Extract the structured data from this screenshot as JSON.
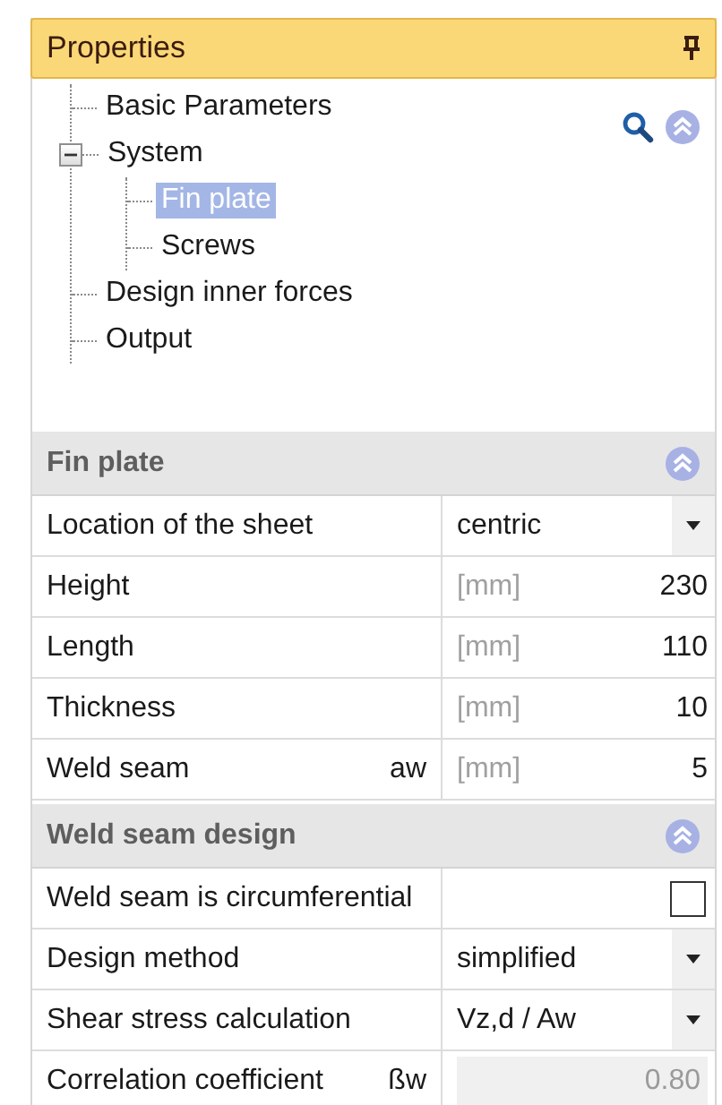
{
  "panel": {
    "title": "Properties",
    "pinned": true
  },
  "tree": [
    {
      "label": "Basic Parameters",
      "selected": false
    },
    {
      "label": "System",
      "selected": false,
      "expanded": true,
      "children": [
        {
          "label": "Fin plate",
          "selected": true
        },
        {
          "label": "Screws",
          "selected": false
        }
      ]
    },
    {
      "label": "Design inner forces",
      "selected": false
    },
    {
      "label": "Output",
      "selected": false
    }
  ],
  "sections": [
    {
      "title": "Fin plate",
      "expanded": true,
      "rows": [
        {
          "kind": "dropdown",
          "label": "Location of the sheet",
          "value": "centric"
        },
        {
          "kind": "number",
          "label": "Height",
          "unit": "[mm]",
          "value": "230"
        },
        {
          "kind": "number",
          "label": "Length",
          "unit": "[mm]",
          "value": "110"
        },
        {
          "kind": "number",
          "label": "Thickness",
          "unit": "[mm]",
          "value": "10"
        },
        {
          "kind": "number",
          "label": "Weld seam",
          "symbol": "aw",
          "unit": "[mm]",
          "value": "5"
        }
      ]
    },
    {
      "title": "Weld seam design",
      "expanded": true,
      "rows": [
        {
          "kind": "checkbox",
          "label": "Weld seam is circumferential",
          "checked": false
        },
        {
          "kind": "dropdown",
          "label": "Design method",
          "value": "simplified"
        },
        {
          "kind": "dropdown",
          "label": "Shear stress calculation",
          "value": "Vz,d / Aw"
        },
        {
          "kind": "readonly",
          "label": "Correlation coefficient",
          "symbol": "ßw",
          "value": "0.80"
        }
      ]
    }
  ]
}
